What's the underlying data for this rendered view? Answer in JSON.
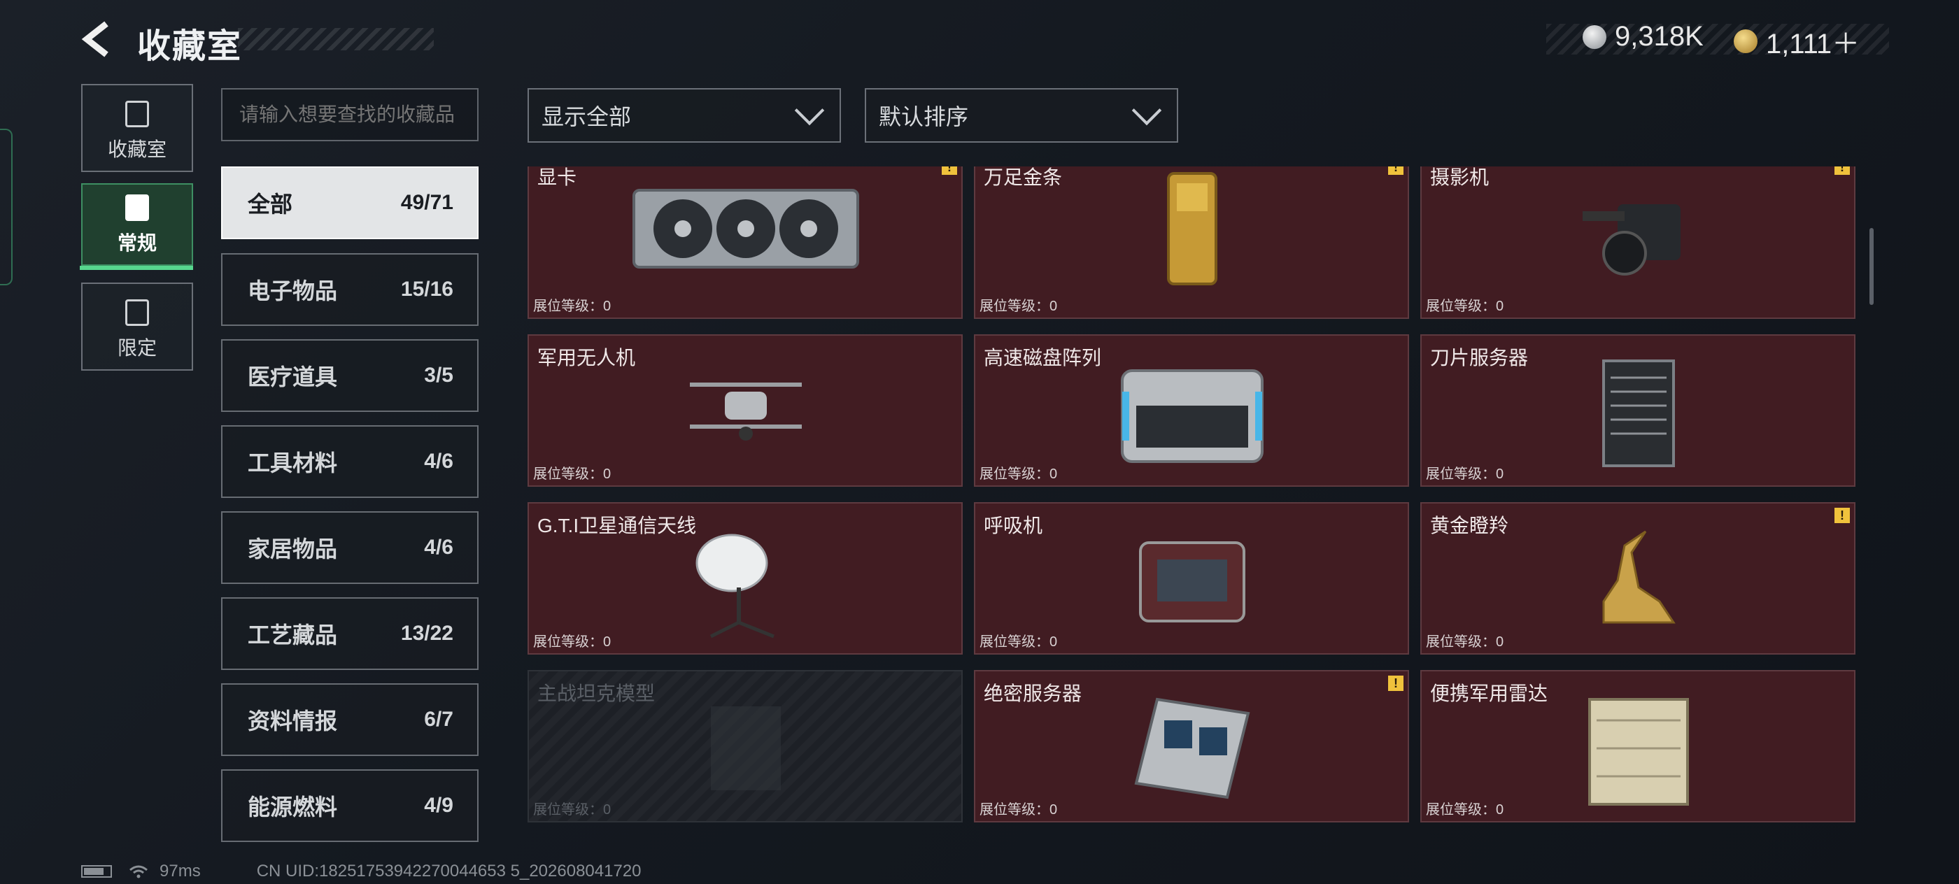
{
  "header": {
    "title": "收藏室"
  },
  "currency": [
    {
      "icon": "silver-coin-icon",
      "value": "9,318K"
    },
    {
      "icon": "gold-coin-icon",
      "value": "1,111＋"
    }
  ],
  "side_tabs": [
    {
      "label": "收藏室",
      "icon": "collection-icon",
      "active": false
    },
    {
      "label": "常规",
      "icon": "regular-icon",
      "active": true
    },
    {
      "label": "限定",
      "icon": "limited-icon",
      "active": false
    }
  ],
  "search": {
    "placeholder": "请输入想要查找的收藏品"
  },
  "filters": {
    "display": "显示全部",
    "sort": "默认排序"
  },
  "categories": [
    {
      "name": "全部",
      "count": "49/71"
    },
    {
      "name": "电子物品",
      "count": "15/16"
    },
    {
      "name": "医疗道具",
      "count": "3/5"
    },
    {
      "name": "工具材料",
      "count": "4/6"
    },
    {
      "name": "家居物品",
      "count": "4/6"
    },
    {
      "name": "工艺藏品",
      "count": "13/22"
    },
    {
      "name": "资料情报",
      "count": "6/7"
    },
    {
      "name": "能源燃料",
      "count": "4/9"
    }
  ],
  "items": [
    {
      "name": "显卡",
      "level": "展位等级：0",
      "warn": true,
      "locked": false
    },
    {
      "name": "万足金条",
      "level": "展位等级：0",
      "warn": true,
      "locked": false
    },
    {
      "name": "摄影机",
      "level": "展位等级：0",
      "warn": true,
      "locked": false
    },
    {
      "name": "军用无人机",
      "level": "展位等级：0",
      "warn": false,
      "locked": false
    },
    {
      "name": "高速磁盘阵列",
      "level": "展位等级：0",
      "warn": false,
      "locked": false
    },
    {
      "name": "刀片服务器",
      "level": "展位等级：0",
      "warn": false,
      "locked": false
    },
    {
      "name": "G.T.I卫星通信天线",
      "level": "展位等级：0",
      "warn": false,
      "locked": false
    },
    {
      "name": "呼吸机",
      "level": "展位等级：0",
      "warn": false,
      "locked": false
    },
    {
      "name": "黄金瞪羚",
      "level": "展位等级：0",
      "warn": true,
      "locked": false
    },
    {
      "name": "主战坦克模型",
      "level": "展位等级：0",
      "warn": false,
      "locked": true
    },
    {
      "name": "绝密服务器",
      "level": "展位等级：0",
      "warn": true,
      "locked": false
    },
    {
      "name": "便携军用雷达",
      "level": "展位等级：0",
      "warn": false,
      "locked": false
    }
  ],
  "warn_glyph": "!",
  "footer": {
    "ping": "97ms",
    "uid": "CN UID:18251753942270044653 5_202608041720"
  }
}
